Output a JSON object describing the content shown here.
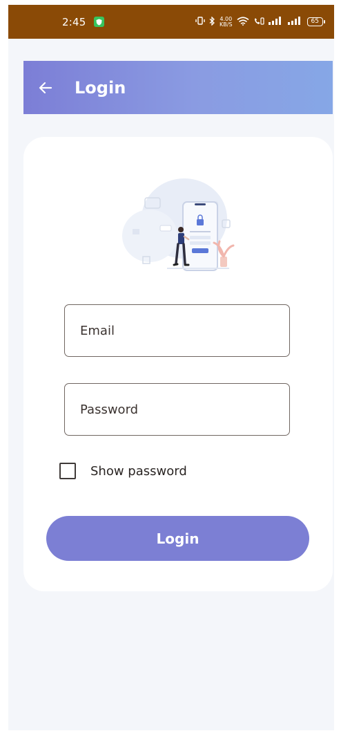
{
  "status_bar": {
    "time": "2:45",
    "net_speed_value": "4.00",
    "net_speed_unit": "KB/S",
    "battery": "65",
    "bg_color": "#8a4a06"
  },
  "app_bar": {
    "title": "Login",
    "back_icon": "arrow-left-icon",
    "gradient": [
      "#7c7ed6",
      "#86a7e6"
    ]
  },
  "form": {
    "email_placeholder": "Email",
    "email_value": "",
    "password_placeholder": "Password",
    "password_value": "",
    "show_password_label": "Show password",
    "show_password_checked": false,
    "login_label": "Login"
  },
  "colors": {
    "accent": "#7c7fd4",
    "screen_bg": "#f4f6fa",
    "card_bg": "#ffffff"
  }
}
